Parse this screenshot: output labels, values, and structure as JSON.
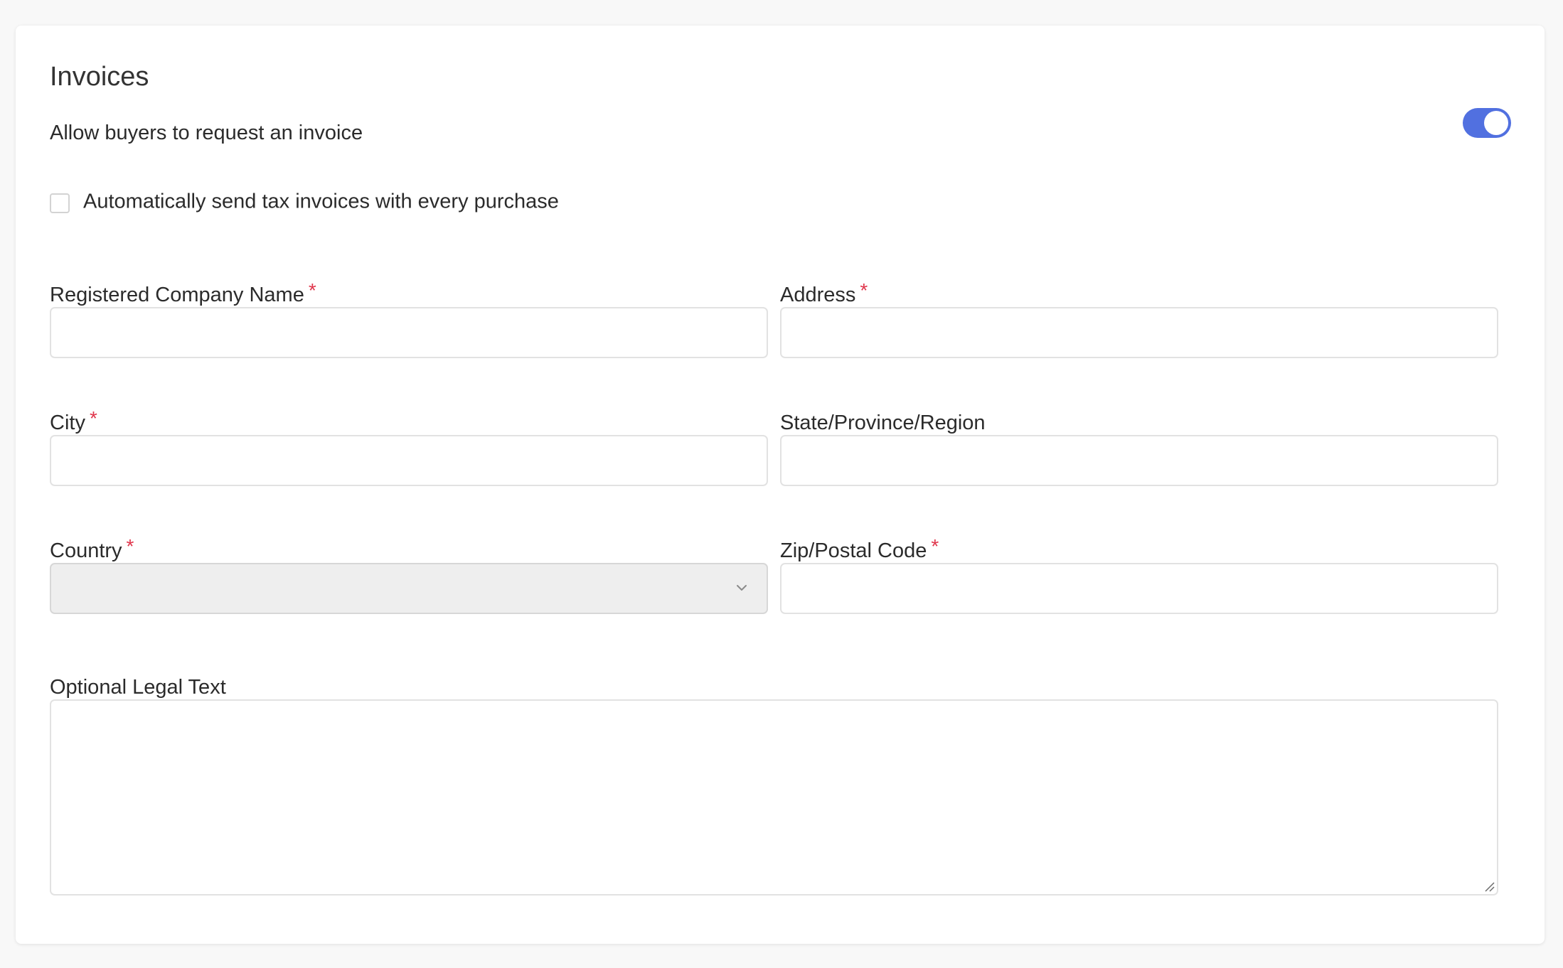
{
  "invoices": {
    "title": "Invoices",
    "allow_label": "Allow buyers to request an invoice",
    "allow_enabled": true,
    "auto_send_label": "Automatically send tax invoices with every purchase",
    "auto_send_checked": false,
    "required_marker": "*",
    "fields": {
      "company_name": {
        "label": "Registered Company Name",
        "required": true,
        "value": ""
      },
      "address": {
        "label": "Address",
        "required": true,
        "value": ""
      },
      "city": {
        "label": "City",
        "required": true,
        "value": ""
      },
      "state": {
        "label": "State/Province/Region",
        "required": false,
        "value": ""
      },
      "country": {
        "label": "Country",
        "required": true,
        "value": ""
      },
      "zip": {
        "label": "Zip/Postal Code",
        "required": true,
        "value": ""
      },
      "legal_text": {
        "label": "Optional Legal Text",
        "required": false,
        "value": ""
      }
    },
    "colors": {
      "accent": "#5170e0",
      "required": "#e0364c",
      "disabled_bg": "#eeeeee"
    }
  }
}
